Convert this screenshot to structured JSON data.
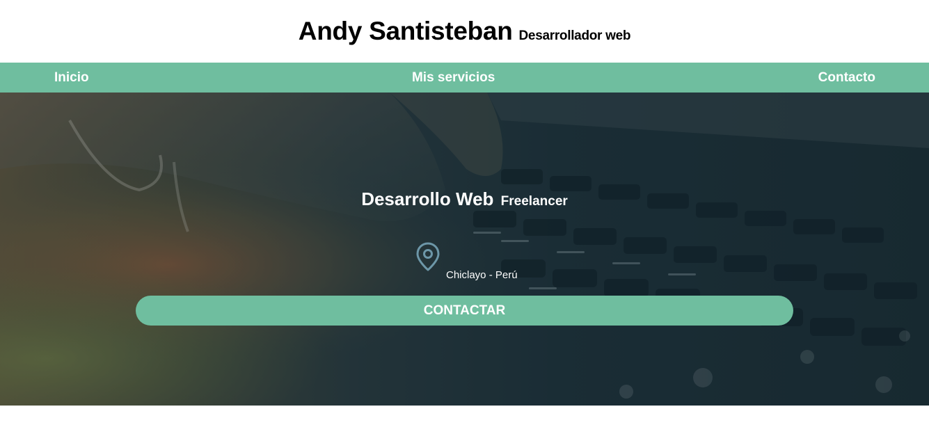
{
  "header": {
    "name": "Andy Santisteban",
    "tagline": "Desarrollador web"
  },
  "nav": {
    "items": [
      {
        "label": "Inicio"
      },
      {
        "label": "Mis servicios"
      },
      {
        "label": "Contacto"
      }
    ]
  },
  "hero": {
    "title": "Desarrollo Web",
    "subtitle": "Freelancer",
    "location_icon": "map-pin-icon",
    "location": "Chiclayo - Perú",
    "cta_label": "CONTACTAR"
  },
  "colors": {
    "accent": "#6fbe9f",
    "text_dark": "#000000",
    "text_light": "#ffffff",
    "hero_dark": "#1b2a32"
  }
}
